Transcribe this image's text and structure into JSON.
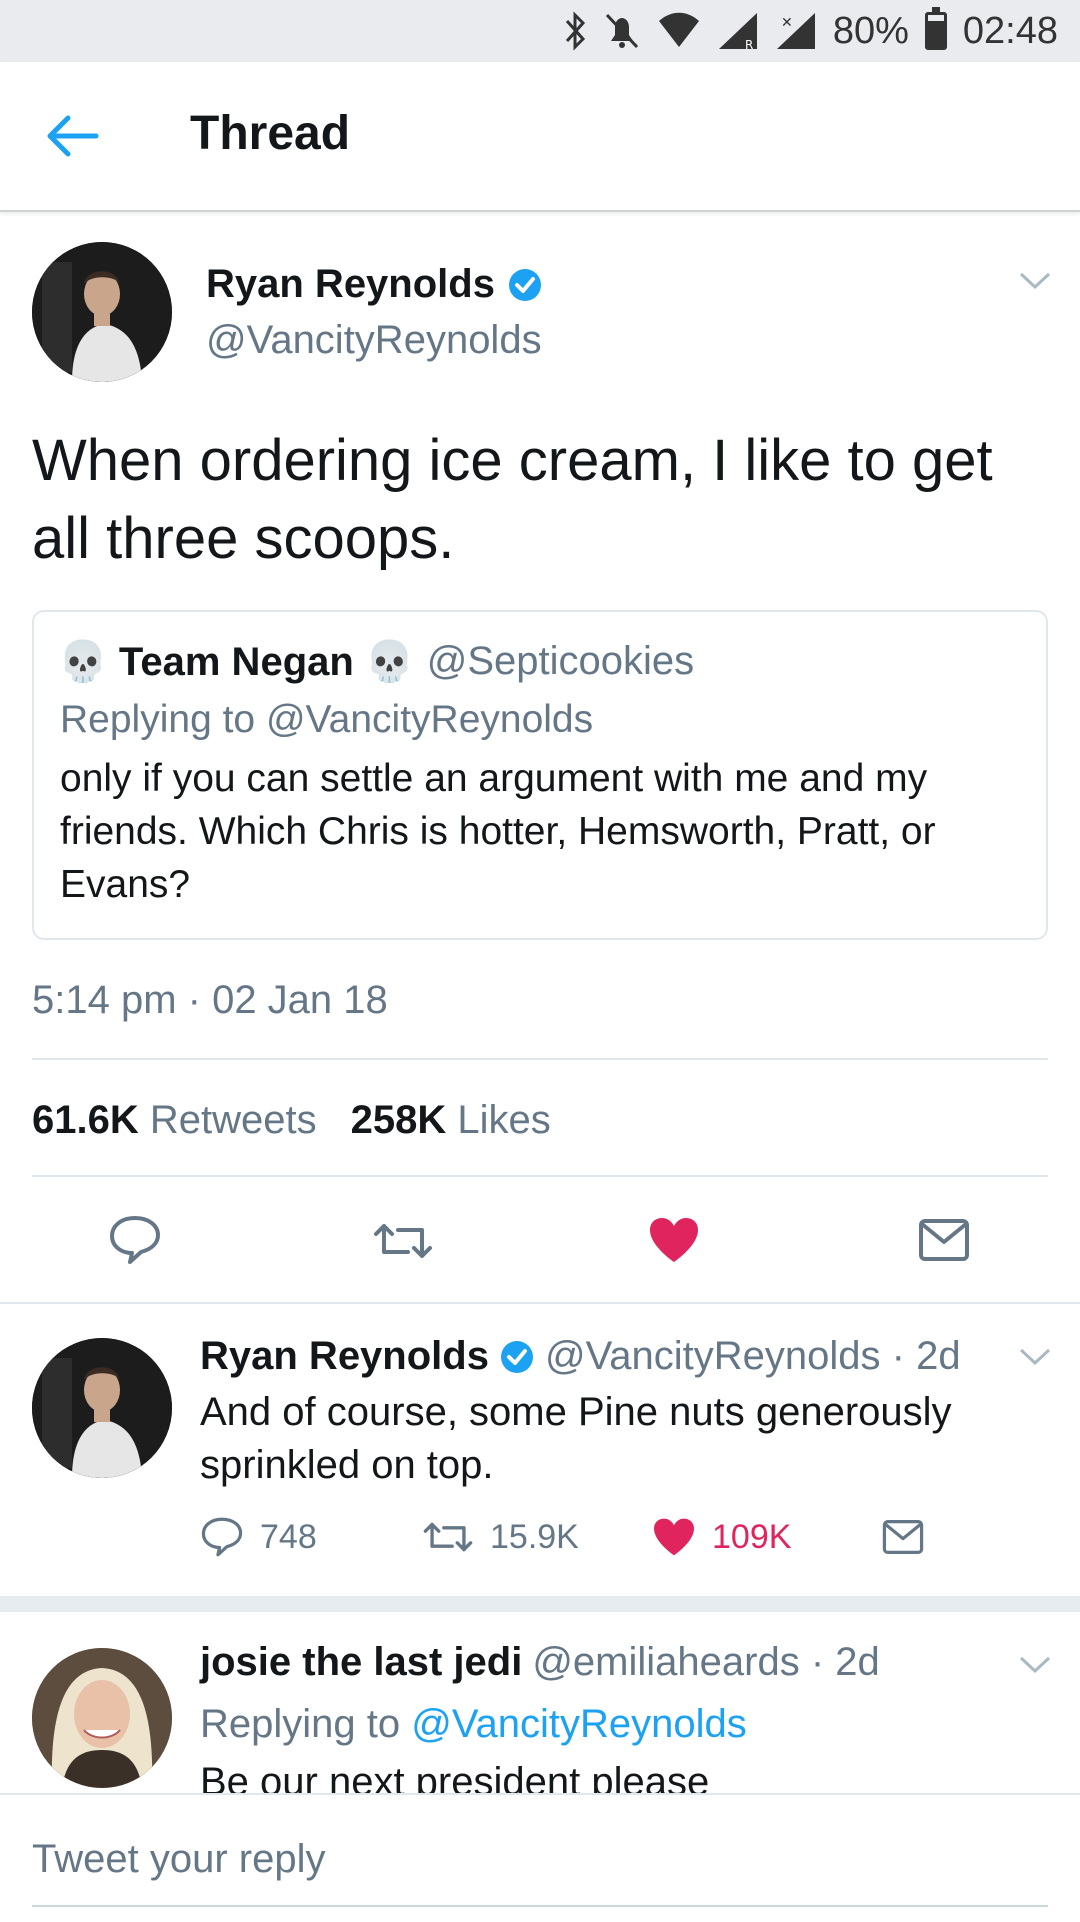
{
  "status_bar": {
    "battery": "80%",
    "time": "02:48",
    "battery_level": 0.8
  },
  "header": {
    "title": "Thread"
  },
  "main_tweet": {
    "name": "Ryan Reynolds",
    "handle": "@VancityReynolds",
    "text": "When ordering ice cream, I like to get all three scoops.",
    "quoted": {
      "name": "💀 Team Negan 💀",
      "handle": "@Septicookies",
      "replying_to": "Replying to @VancityReynolds",
      "text": "only if you can settle an argument with me and my friends. Which Chris is hotter, Hemsworth, Pratt, or Evans?"
    },
    "timestamp": "5:14 pm · 02 Jan 18",
    "retweets_count": "61.6K",
    "retweets_label": "Retweets",
    "likes_count": "258K",
    "likes_label": "Likes"
  },
  "replies": [
    {
      "name": "Ryan Reynolds",
      "handle": "@VancityReynolds · 2d",
      "text": "And of course, some Pine nuts generously sprinkled on top.",
      "reply_count": "748",
      "retweet_count": "15.9K",
      "like_count": "109K"
    },
    {
      "name": "josie the last jedi",
      "handle": "@emiliaheards · 2d",
      "replying_prefix": "Replying to ",
      "replying_handle": "@VancityReynolds",
      "text": "Be our next president please"
    }
  ],
  "composer": {
    "placeholder": "Tweet your reply"
  },
  "colors": {
    "accent": "#1da1f2",
    "like": "#e0245e",
    "secondary_text": "#657786"
  }
}
